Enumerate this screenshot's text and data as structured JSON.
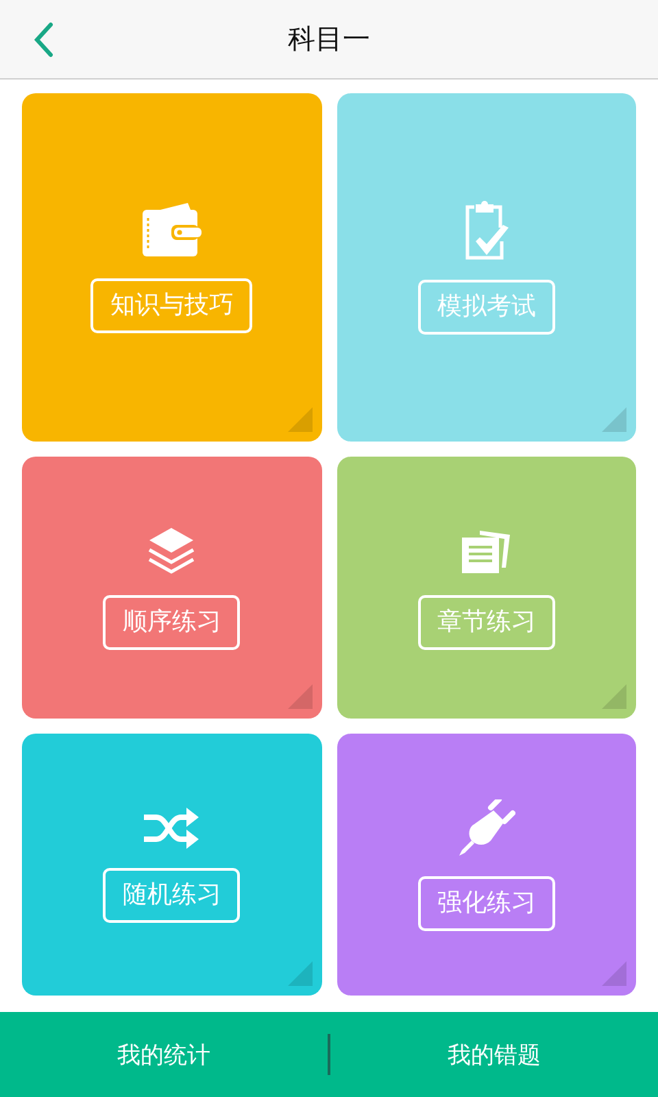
{
  "header": {
    "title": "科目一"
  },
  "tiles": [
    {
      "label": "知识与技巧",
      "color": "#f8b500"
    },
    {
      "label": "模拟考试",
      "color": "#8adfe8"
    },
    {
      "label": "顺序练习",
      "color": "#f27676"
    },
    {
      "label": "章节练习",
      "color": "#a8d174"
    },
    {
      "label": "随机练习",
      "color": "#22ccd8"
    },
    {
      "label": "强化练习",
      "color": "#b97ef5"
    }
  ],
  "bottom_bar": [
    "我的统计",
    "我的错题"
  ]
}
